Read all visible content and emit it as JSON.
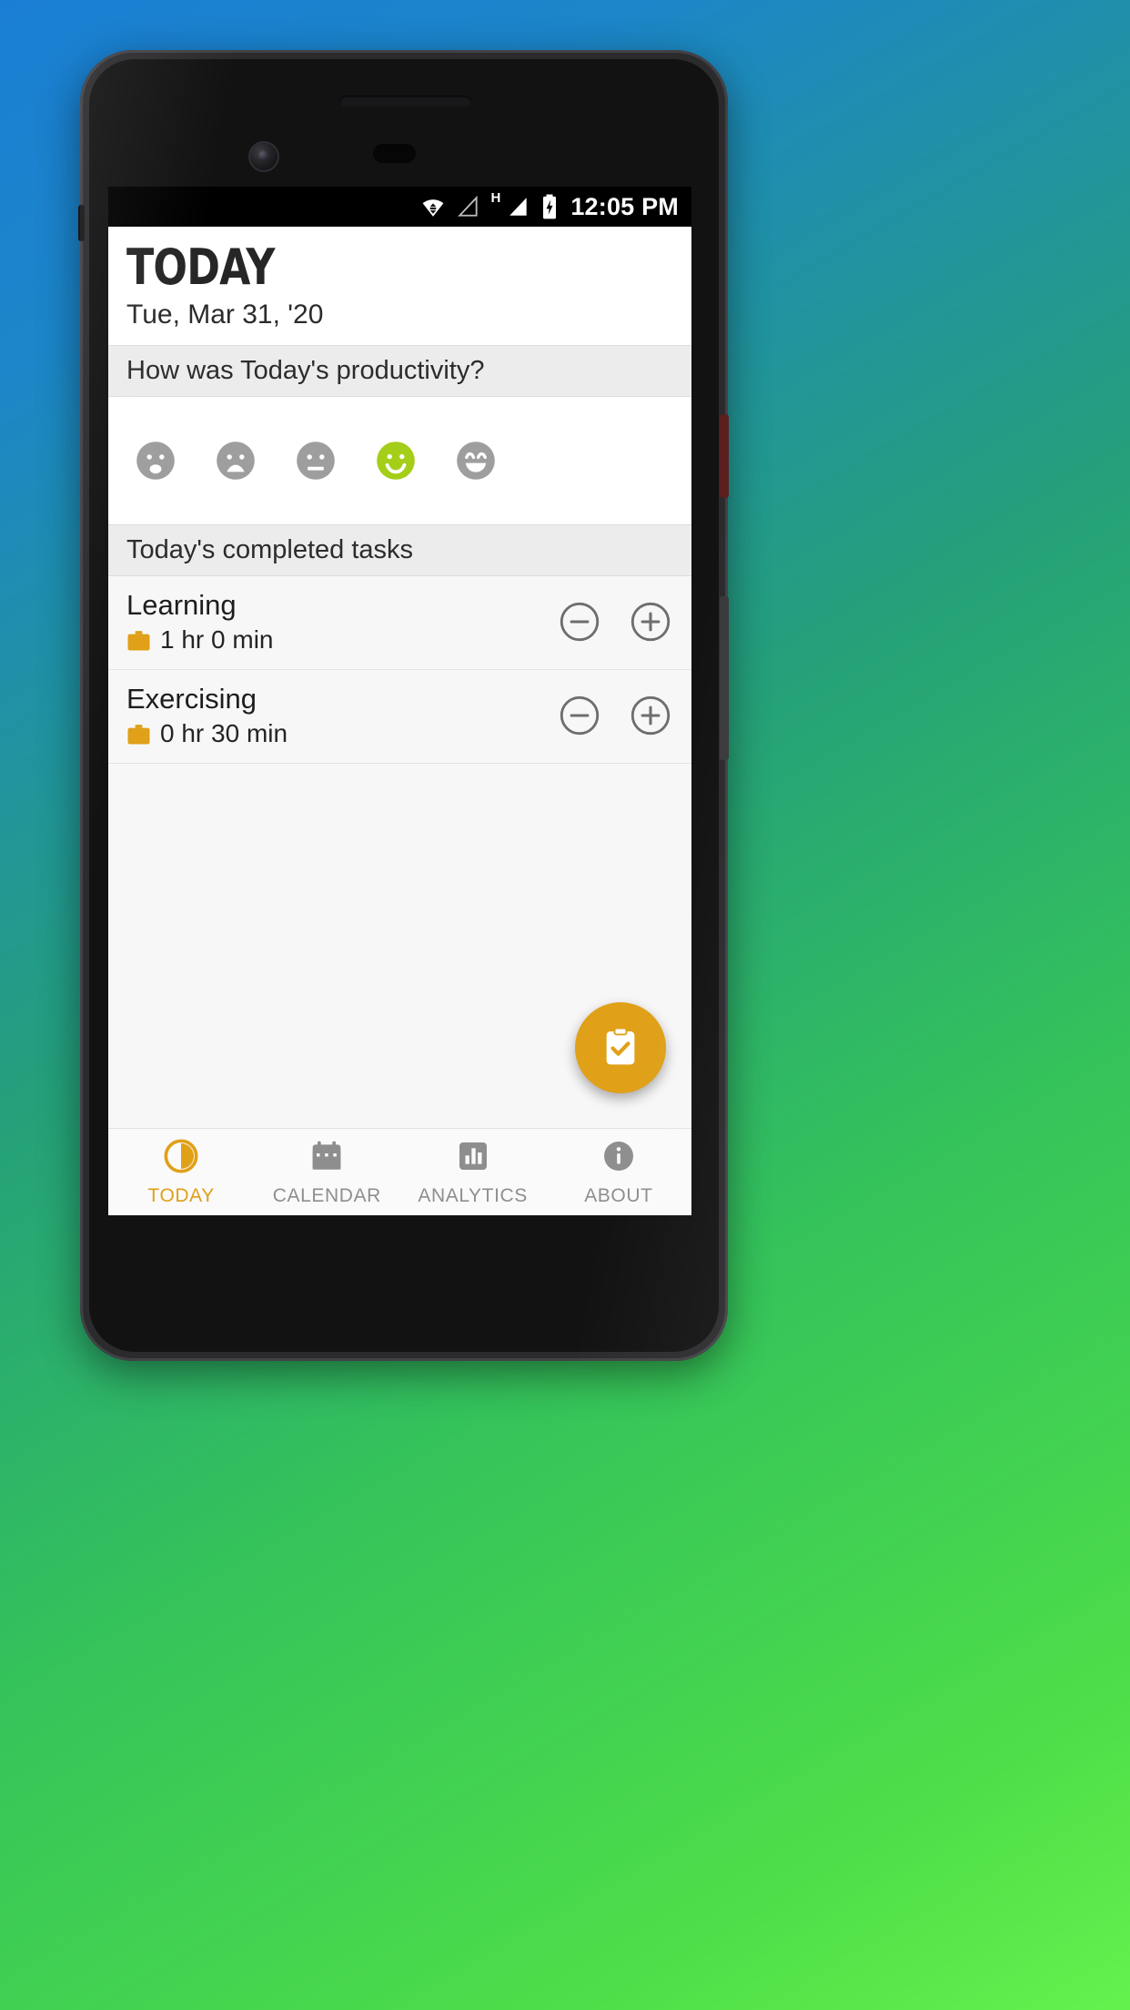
{
  "status_bar": {
    "time": "12:05 PM",
    "network_type": "H",
    "icons": [
      "wifi-icon",
      "signal-triangle-icon",
      "signal-bars-icon",
      "battery-charging-icon"
    ]
  },
  "header": {
    "title": "TODAY",
    "date": "Tue, Mar 31, '20"
  },
  "productivity": {
    "question": "How was Today's productivity?",
    "selected_index": 3,
    "selected_color": "#a4ce18",
    "inactive_color": "#9e9e9e",
    "faces": [
      {
        "name": "face-very-sad",
        "label": "Very bad"
      },
      {
        "name": "face-sad",
        "label": "Bad"
      },
      {
        "name": "face-neutral",
        "label": "Neutral"
      },
      {
        "name": "face-happy",
        "label": "Good"
      },
      {
        "name": "face-very-happy",
        "label": "Great"
      }
    ]
  },
  "tasks_section": {
    "header": "Today's completed tasks",
    "icon_color": "#e0a018",
    "items": [
      {
        "name": "Learning",
        "hours": "1",
        "hours_unit": "hr",
        "minutes": "0",
        "minutes_unit": "min",
        "duration": "1  hr 0  min",
        "decrease_label": "minus",
        "increase_label": "plus"
      },
      {
        "name": "Exercising",
        "hours": "0",
        "hours_unit": "hr",
        "minutes": "30",
        "minutes_unit": "min",
        "duration": "0  hr 30 min",
        "decrease_label": "minus",
        "increase_label": "plus"
      }
    ]
  },
  "fab": {
    "label": "Add completed task",
    "icon": "clipboard-check-icon",
    "color": "#e0a018"
  },
  "bottom_nav": {
    "active_index": 0,
    "active_color": "#e0a018",
    "inactive_color": "#8e8e8e",
    "items": [
      {
        "label": "TODAY",
        "icon": "clock-pie-icon"
      },
      {
        "label": "CALENDAR",
        "icon": "calendar-icon"
      },
      {
        "label": "ANALYTICS",
        "icon": "bar-chart-icon"
      },
      {
        "label": "ABOUT",
        "icon": "info-icon"
      }
    ]
  }
}
